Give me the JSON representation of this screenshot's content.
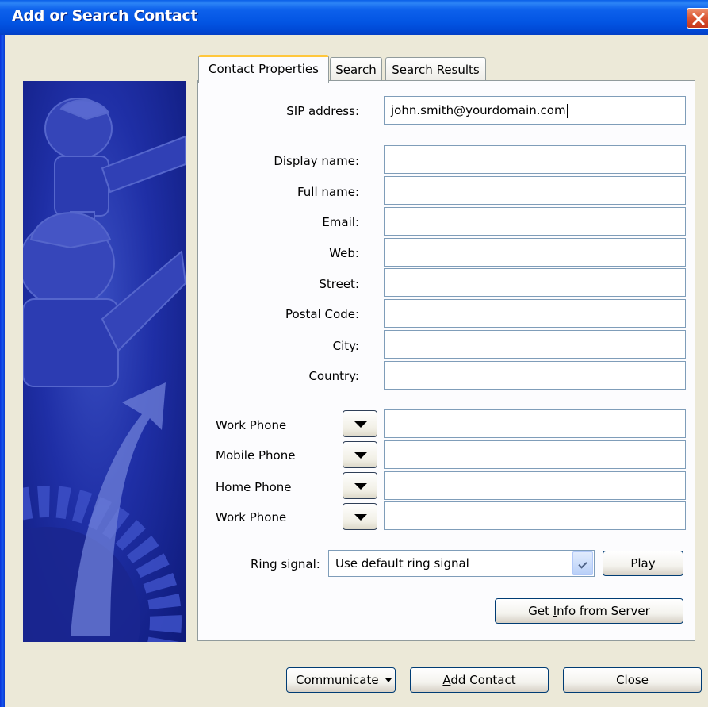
{
  "window": {
    "title": "Add or Search Contact"
  },
  "tabs": [
    {
      "label": "Contact Properties"
    },
    {
      "label": "Search"
    },
    {
      "label": "Search Results"
    }
  ],
  "contact": {
    "sip_label": "SIP address:",
    "sip_value": "john.smith@yourdomain.com",
    "fields": [
      {
        "label": "Display name:",
        "value": ""
      },
      {
        "label": "Full name:",
        "value": ""
      },
      {
        "label": "Email:",
        "value": ""
      },
      {
        "label": "Web:",
        "value": ""
      },
      {
        "label": "Street:",
        "value": ""
      },
      {
        "label": "Postal Code:",
        "value": ""
      },
      {
        "label": "City:",
        "value": ""
      },
      {
        "label": "Country:",
        "value": ""
      }
    ],
    "phones": [
      {
        "label": "Work Phone",
        "value": ""
      },
      {
        "label": "Mobile Phone",
        "value": ""
      },
      {
        "label": "Home Phone",
        "value": ""
      },
      {
        "label": "Work Phone",
        "value": ""
      }
    ],
    "ring_label": "Ring signal:",
    "ring_value": "Use default ring signal",
    "play_label": "Play",
    "get_info_prefix": "Get ",
    "get_info_mnemonic": "I",
    "get_info_suffix": "nfo from Server"
  },
  "footer": {
    "communicate_label": "Communicate",
    "add_contact_mnemonic": "A",
    "add_contact_suffix": "dd Contact",
    "close_label": "Close"
  },
  "icons": {
    "close": "close-icon",
    "dropdown": "chevron-down-icon"
  },
  "colors": {
    "titlebar": "#0355E3",
    "tab_highlight": "#FFC73C",
    "dialog_bg": "#ECE9D8",
    "close_button": "#DA5532",
    "banner": "#1F2FA6"
  }
}
